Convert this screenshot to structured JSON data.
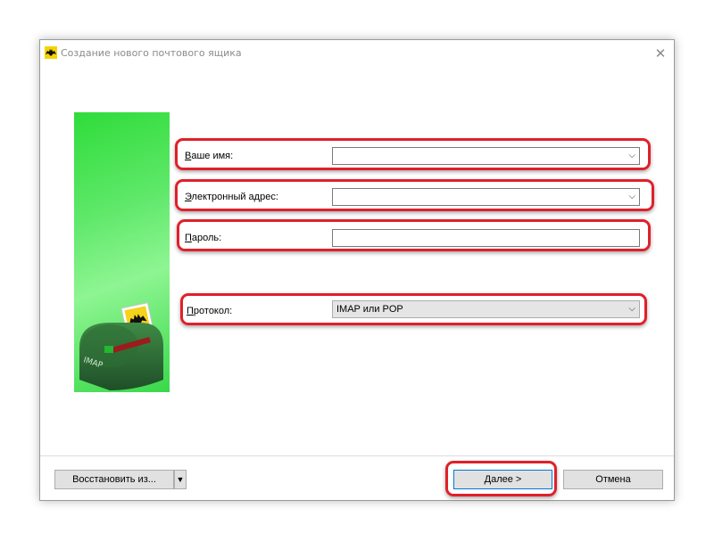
{
  "window": {
    "title": "Создание нового почтового ящика",
    "close_glyph": "✕"
  },
  "form": {
    "name": {
      "label_u": "В",
      "label_rest": "аше имя:",
      "value": ""
    },
    "email": {
      "label_u": "Э",
      "label_rest": "лектронный адрес:",
      "value": ""
    },
    "password": {
      "label_u": "П",
      "label_rest": "ароль:",
      "value": ""
    },
    "protocol": {
      "label_u": "П",
      "label_rest": "ротокол:",
      "value": "IMAP или POP"
    }
  },
  "footer": {
    "restore_label": "Восстановить из...",
    "next_label": "Далее >",
    "cancel_label": "Отмена"
  },
  "colors": {
    "highlight": "#e0202a",
    "side_green": "#3edc4a",
    "primary_border": "#0078d7"
  },
  "icons": {
    "app": "bat-icon",
    "dropdown": "chevron-down-icon",
    "mailbox": "mailbox-icon"
  },
  "mailbox_label": "IMAP"
}
